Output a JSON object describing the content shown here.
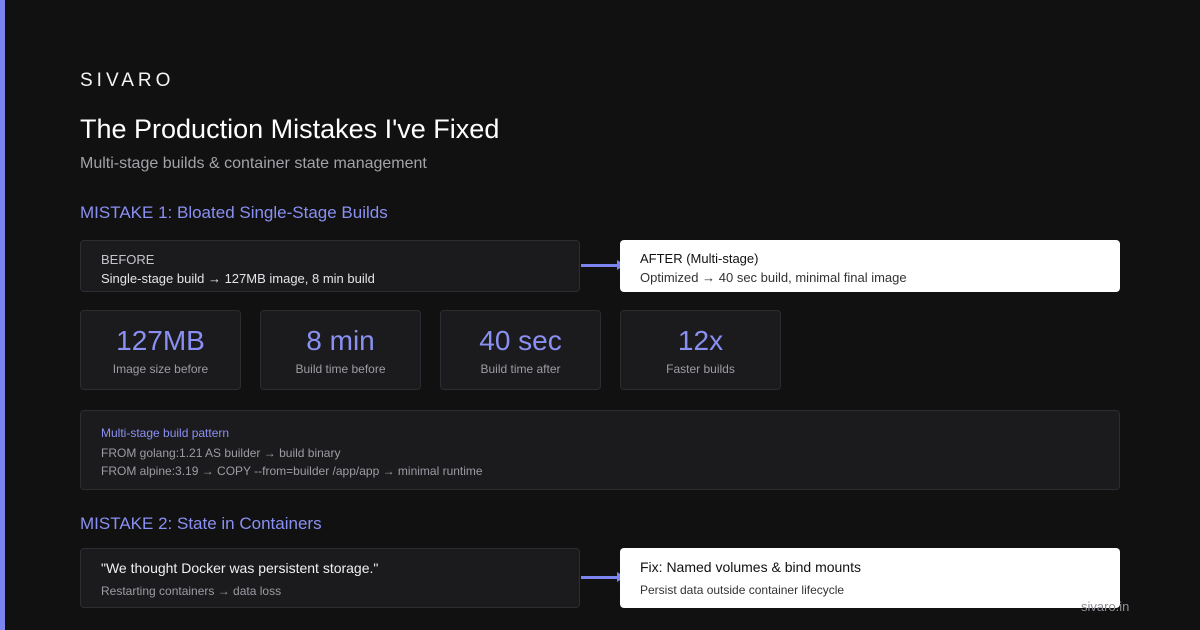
{
  "brand": "SIVARO",
  "title": "The Production Mistakes I've Fixed",
  "subtitle": "Multi-stage builds & container state management",
  "mistake1": {
    "heading": "MISTAKE 1: Bloated Single-Stage Builds",
    "before": {
      "label": "BEFORE",
      "text": "Single-stage build → 127MB image, 8 min build"
    },
    "after": {
      "label": "AFTER (Multi-stage)",
      "text": "Optimized → 40 sec build, minimal final image"
    },
    "stats": [
      {
        "value": "127MB",
        "caption": "Image size before"
      },
      {
        "value": "8 min",
        "caption": "Build time before"
      },
      {
        "value": "40 sec",
        "caption": "Build time after"
      },
      {
        "value": "12x",
        "caption": "Faster builds"
      }
    ],
    "code": {
      "title": "Multi-stage build pattern",
      "lines": [
        "FROM golang:1.21 AS builder → build binary",
        "FROM alpine:3.19 → COPY --from=builder /app/app → minimal runtime"
      ]
    }
  },
  "mistake2": {
    "heading": "MISTAKE 2: State in Containers",
    "quote": {
      "label": "\"We thought Docker was persistent storage.\"",
      "text": "Restarting containers → data loss"
    },
    "fix": {
      "label": "Fix: Named volumes & bind mounts",
      "text": "Persist data outside container lifecycle"
    }
  },
  "footer": {
    "url": "sivaro.in"
  },
  "colors": {
    "accent": "#7c84f0",
    "background": "#111112"
  }
}
